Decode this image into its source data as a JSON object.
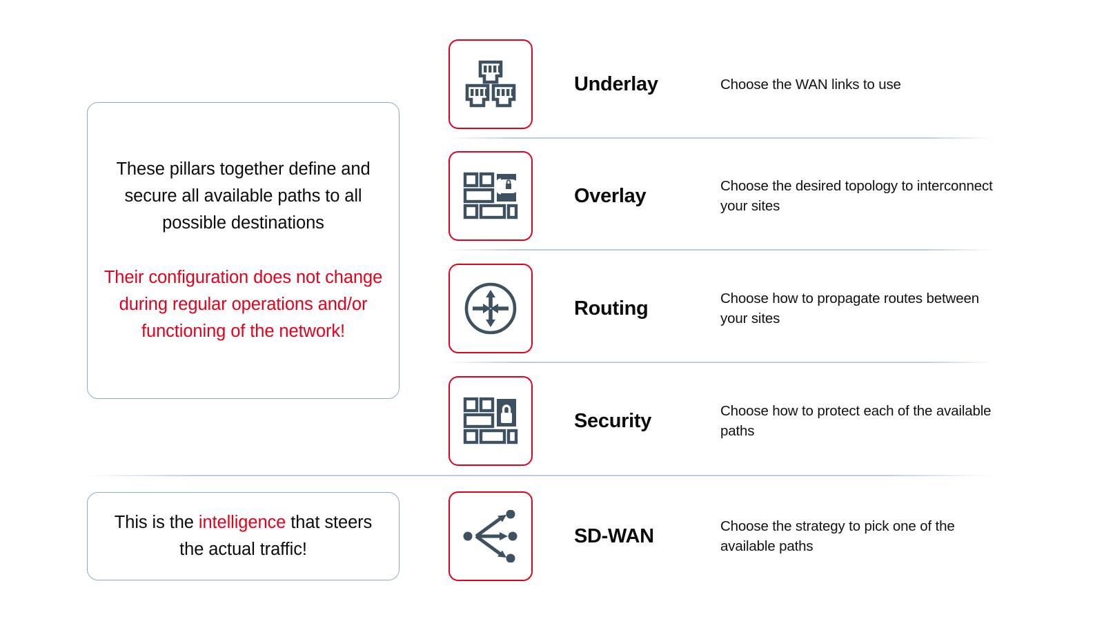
{
  "left_panel": {
    "primary_card": {
      "black_text": "These pillars together define and secure all available paths to all possible destinations",
      "red_text": "Their configuration does not change during regular operations and/or functioning of the network!"
    },
    "secondary_card": {
      "prefix": "This is the ",
      "accent": "intelligence",
      "suffix": " that steers the actual traffic!"
    }
  },
  "pillars": [
    {
      "title": "Underlay",
      "description": "Choose the WAN links to use",
      "icon": "ethernet-ports-icon"
    },
    {
      "title": "Overlay",
      "description": "Choose the desired topology to interconnect your sites",
      "icon": "overlay-tunnel-icon"
    },
    {
      "title": "Routing",
      "description": "Choose how to propagate routes between your sites",
      "icon": "router-arrows-icon"
    },
    {
      "title": "Security",
      "description": "Choose how to protect each of the available paths",
      "icon": "padlock-blocks-icon"
    },
    {
      "title": "SD-WAN",
      "description": "Choose the strategy to pick one of the available paths",
      "icon": "path-branching-icon"
    }
  ],
  "colors": {
    "accent_red": "#e3001b",
    "icon_slate": "#3d5160",
    "card_border_blue": "#8fa9c6",
    "divider_blue": "#bacbe0",
    "text_black": "#0b0b0b",
    "background": "#ffffff"
  }
}
